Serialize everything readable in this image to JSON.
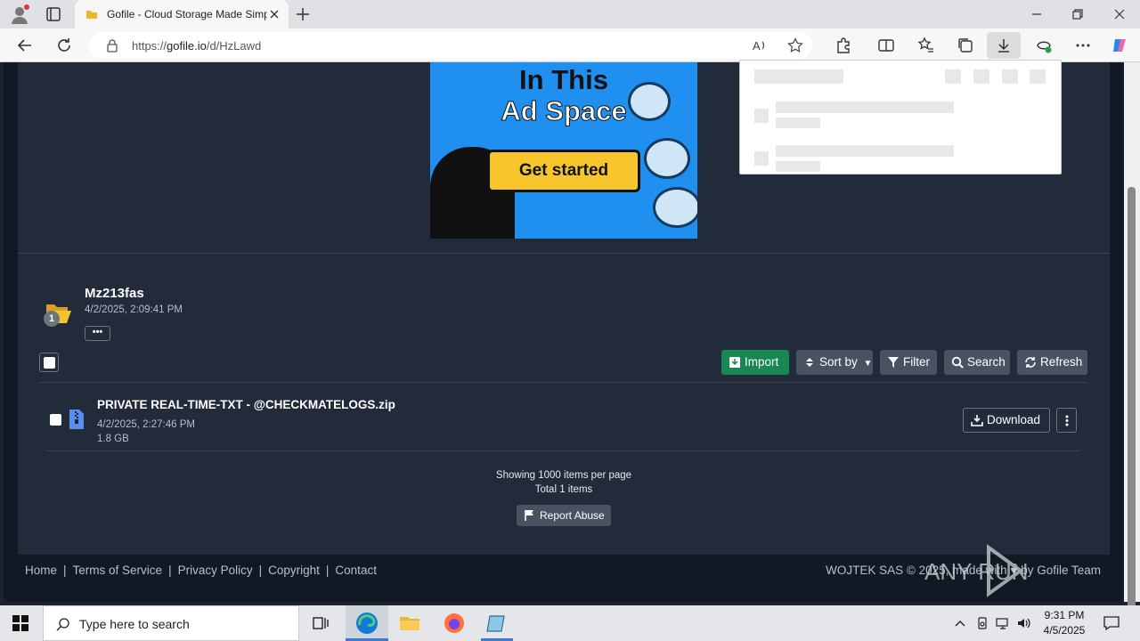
{
  "browser": {
    "tab_title": "Gofile - Cloud Storage Made Simple",
    "url_scheme": "https://",
    "url_host": "gofile.io",
    "url_path": "/d/HzLawd"
  },
  "ad": {
    "line1": "In This",
    "line2": "Ad Space",
    "cta": "Get started"
  },
  "folder": {
    "name": "Mz213fas",
    "date": "4/2/2025, 2:09:41 PM",
    "count": "1",
    "more": "•••"
  },
  "toolbar": {
    "import": "Import",
    "sort": "Sort by",
    "filter": "Filter",
    "search": "Search",
    "refresh": "Refresh"
  },
  "files": [
    {
      "name": "PRIVATE REAL-TIME-TXT - @CHECKMATELOGS.zip",
      "date": "4/2/2025, 2:27:46 PM",
      "size": "1.8 GB",
      "download_label": "Download"
    }
  ],
  "summary": {
    "per_page": "Showing 1000 items per page",
    "total": "Total 1 items",
    "report": "Report Abuse"
  },
  "footer": {
    "links": [
      "Home",
      "Terms of Service",
      "Privacy Policy",
      "Copyright",
      "Contact"
    ],
    "separator": "|",
    "copyright": "WOJTEK SAS © 2025, made with ♥ by Gofile Team"
  },
  "watermark": "ANY RUN",
  "taskbar": {
    "search_placeholder": "Type here to search",
    "time": "9:31 PM",
    "date": "4/5/2025"
  },
  "colors": {
    "accent_green": "#198754",
    "panel_bg": "#222b3a",
    "page_bg": "#121824"
  }
}
